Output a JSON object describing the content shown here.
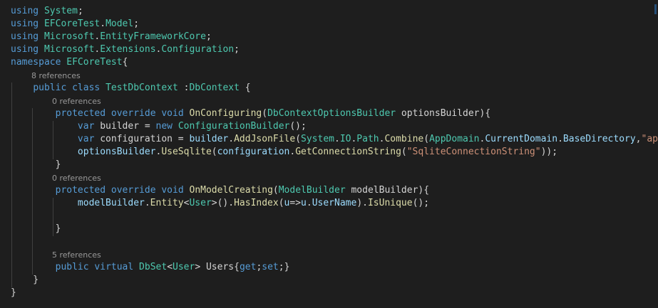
{
  "editor": {
    "language": "C#",
    "theme": "dark",
    "colors": {
      "background": "#1e1e1e",
      "keyword": "#569cd6",
      "type": "#4ec9b0",
      "method": "#dcdcaa",
      "variable": "#9cdcfe",
      "string": "#ce9178",
      "plain": "#d4d4d4",
      "codelens": "#999999"
    },
    "code_lines": [
      [
        [
          "kw",
          "using"
        ],
        [
          "pl",
          " "
        ],
        [
          "ns",
          "System"
        ],
        [
          "pl",
          ";"
        ]
      ],
      [
        [
          "kw",
          "using"
        ],
        [
          "pl",
          " "
        ],
        [
          "ns",
          "EFCoreTest"
        ],
        [
          "pl",
          "."
        ],
        [
          "ns",
          "Model"
        ],
        [
          "pl",
          ";"
        ]
      ],
      [
        [
          "kw",
          "using"
        ],
        [
          "pl",
          " "
        ],
        [
          "ns",
          "Microsoft"
        ],
        [
          "pl",
          "."
        ],
        [
          "ns",
          "EntityFrameworkCore"
        ],
        [
          "pl",
          ";"
        ]
      ],
      [
        [
          "kw",
          "using"
        ],
        [
          "pl",
          " "
        ],
        [
          "ns",
          "Microsoft"
        ],
        [
          "pl",
          "."
        ],
        [
          "ns",
          "Extensions"
        ],
        [
          "pl",
          "."
        ],
        [
          "ns",
          "Configuration"
        ],
        [
          "pl",
          ";"
        ]
      ],
      [
        [
          "kw",
          "namespace"
        ],
        [
          "pl",
          " "
        ],
        [
          "ns",
          "EFCoreTest"
        ],
        [
          "pl",
          "{"
        ]
      ],
      [
        [
          "pl",
          "    "
        ],
        [
          "kw",
          "public"
        ],
        [
          "pl",
          " "
        ],
        [
          "kw",
          "class"
        ],
        [
          "pl",
          " "
        ],
        [
          "ns",
          "TestDbContext"
        ],
        [
          "pl",
          " :"
        ],
        [
          "ns",
          "DbContext"
        ],
        [
          "pl",
          " {"
        ]
      ],
      [
        [
          "pl",
          "        "
        ],
        [
          "kw",
          "protected"
        ],
        [
          "pl",
          " "
        ],
        [
          "kw",
          "override"
        ],
        [
          "pl",
          " "
        ],
        [
          "kw",
          "void"
        ],
        [
          "pl",
          " "
        ],
        [
          "fn",
          "OnConfiguring"
        ],
        [
          "pl",
          "("
        ],
        [
          "ns",
          "DbContextOptionsBuilder"
        ],
        [
          "pl",
          " optionsBuilder){"
        ]
      ],
      [
        [
          "pl",
          "            "
        ],
        [
          "kw",
          "var"
        ],
        [
          "pl",
          " builder = "
        ],
        [
          "kw",
          "new"
        ],
        [
          "pl",
          " "
        ],
        [
          "ns",
          "ConfigurationBuilder"
        ],
        [
          "pl",
          "();"
        ]
      ],
      [
        [
          "pl",
          "            "
        ],
        [
          "kw",
          "var"
        ],
        [
          "pl",
          " configuration = "
        ],
        [
          "var",
          "builder"
        ],
        [
          "pl",
          "."
        ],
        [
          "fn",
          "AddJsonFile"
        ],
        [
          "pl",
          "("
        ],
        [
          "ns",
          "System"
        ],
        [
          "pl",
          "."
        ],
        [
          "ns",
          "IO"
        ],
        [
          "pl",
          "."
        ],
        [
          "ns",
          "Path"
        ],
        [
          "pl",
          "."
        ],
        [
          "fn",
          "Combine"
        ],
        [
          "pl",
          "("
        ],
        [
          "ns",
          "AppDomain"
        ],
        [
          "pl",
          "."
        ],
        [
          "var",
          "CurrentDomain"
        ],
        [
          "pl",
          "."
        ],
        [
          "var",
          "BaseDirectory"
        ],
        [
          "pl",
          ","
        ],
        [
          "str",
          "\"appsetting."
        ]
      ],
      [
        [
          "pl",
          "            "
        ],
        [
          "var",
          "optionsBuilder"
        ],
        [
          "pl",
          "."
        ],
        [
          "fn",
          "UseSqlite"
        ],
        [
          "pl",
          "("
        ],
        [
          "var",
          "configuration"
        ],
        [
          "pl",
          "."
        ],
        [
          "fn",
          "GetConnectionString"
        ],
        [
          "pl",
          "("
        ],
        [
          "str",
          "\"SqliteConnectionString\""
        ],
        [
          "pl",
          "));"
        ]
      ],
      [
        [
          "pl",
          "        }"
        ]
      ],
      [
        [
          "pl",
          "        "
        ],
        [
          "kw",
          "protected"
        ],
        [
          "pl",
          " "
        ],
        [
          "kw",
          "override"
        ],
        [
          "pl",
          " "
        ],
        [
          "kw",
          "void"
        ],
        [
          "pl",
          " "
        ],
        [
          "fn",
          "OnModelCreating"
        ],
        [
          "pl",
          "("
        ],
        [
          "ns",
          "ModelBuilder"
        ],
        [
          "pl",
          " modelBuilder){"
        ]
      ],
      [
        [
          "pl",
          "            "
        ],
        [
          "var",
          "modelBuilder"
        ],
        [
          "pl",
          "."
        ],
        [
          "fn",
          "Entity"
        ],
        [
          "pl",
          "<"
        ],
        [
          "ns",
          "User"
        ],
        [
          "pl",
          ">()."
        ],
        [
          "fn",
          "HasIndex"
        ],
        [
          "pl",
          "("
        ],
        [
          "var",
          "u"
        ],
        [
          "pl",
          "=>"
        ],
        [
          "var",
          "u"
        ],
        [
          "pl",
          "."
        ],
        [
          "var",
          "UserName"
        ],
        [
          "pl",
          ")."
        ],
        [
          "fn",
          "IsUnique"
        ],
        [
          "pl",
          "();"
        ]
      ],
      [],
      [
        [
          "pl",
          "        }"
        ]
      ],
      [],
      [
        [
          "pl",
          "        "
        ],
        [
          "kw",
          "public"
        ],
        [
          "pl",
          " "
        ],
        [
          "kw",
          "virtual"
        ],
        [
          "pl",
          " "
        ],
        [
          "ns",
          "DbSet"
        ],
        [
          "pl",
          "<"
        ],
        [
          "ns",
          "User"
        ],
        [
          "pl",
          "> Users{"
        ],
        [
          "kw",
          "get"
        ],
        [
          "pl",
          ";"
        ],
        [
          "kw",
          "set"
        ],
        [
          "pl",
          ";}"
        ]
      ],
      [
        [
          "pl",
          "    }"
        ]
      ],
      [
        [
          "pl",
          "}"
        ]
      ]
    ],
    "codelens": [
      {
        "text": "8 references"
      },
      {
        "text": "0 references"
      },
      {
        "text": "0 references"
      },
      {
        "text": "5 references"
      }
    ]
  }
}
